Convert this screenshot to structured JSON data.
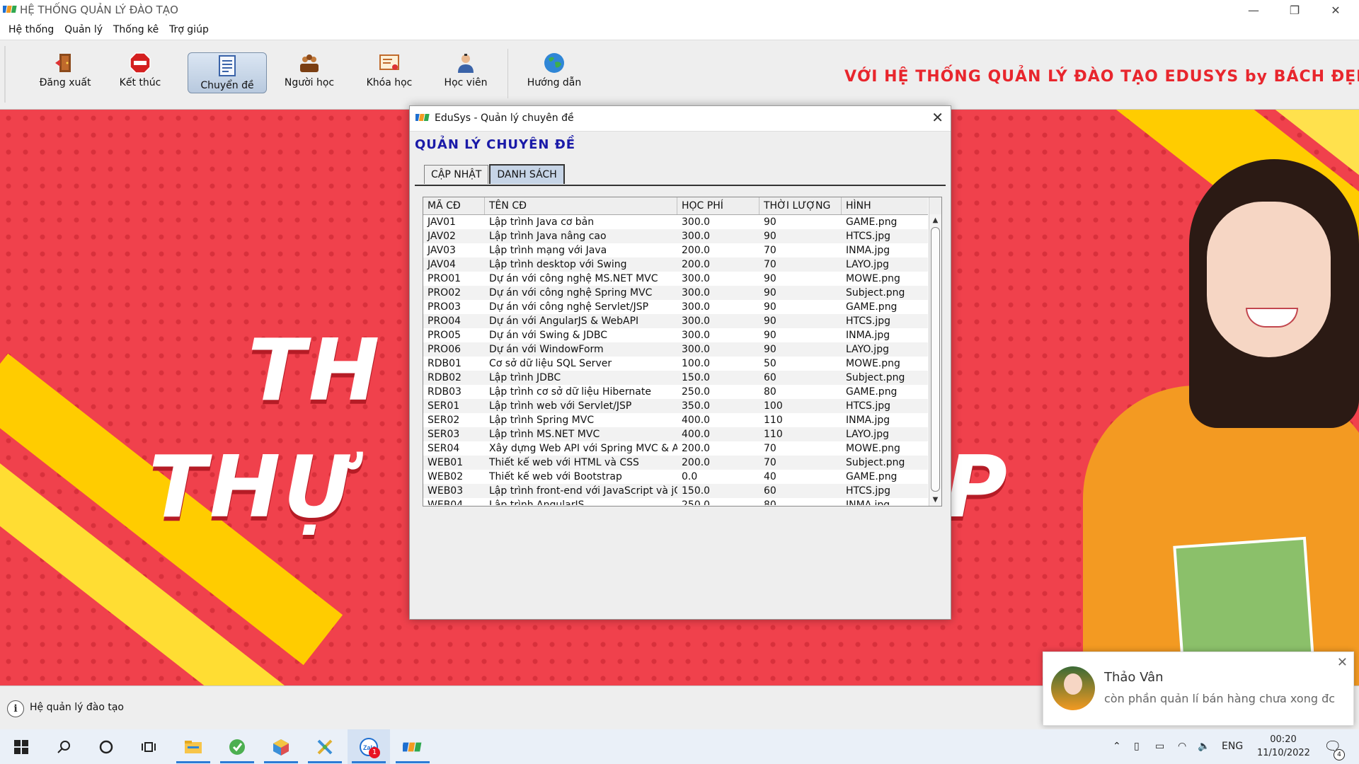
{
  "window": {
    "title": "HỆ THỐNG QUẢN LÝ ĐÀO TẠO",
    "minimize": "—",
    "restore": "❐",
    "close": "✕"
  },
  "menu": [
    "Hệ thống",
    "Quản lý",
    "Thống kê",
    "Trợ giúp"
  ],
  "toolbar": {
    "buttons": [
      "Đăng xuất",
      "Kết thúc",
      "Chuyển đề",
      "Người học",
      "Khóa học",
      "Học viên",
      "Hướng dẫn"
    ],
    "active_index": 2,
    "slogan": "VỚI HỆ THỐNG QUẢN LÝ ĐÀO TẠO EDUSYS by BÁCH ĐẸP TRAI"
  },
  "background": {
    "line1": "TH",
    "line2": "THỰ",
    "line2_tail": "P"
  },
  "dialog": {
    "title": "EduSys - Quản lý chuyên đề",
    "heading": "QUẢN LÝ CHUYÊN ĐỀ",
    "tabs": [
      "CẬP NHẬT",
      "DANH SÁCH"
    ],
    "active_tab": "DANH SÁCH",
    "columns": [
      "MÃ CĐ",
      "TÊN CĐ",
      "HỌC PHÍ",
      "THỜI LƯỢNG",
      "HÌNH"
    ],
    "rows": [
      [
        "JAV01",
        "Lập trình Java cơ bản",
        "300.0",
        "90",
        "GAME.png"
      ],
      [
        "JAV02",
        "Lập trình Java nâng cao",
        "300.0",
        "90",
        "HTCS.jpg"
      ],
      [
        "JAV03",
        "Lập trình mạng với Java",
        "200.0",
        "70",
        "INMA.jpg"
      ],
      [
        "JAV04",
        "Lập trình desktop với Swing",
        "200.0",
        "70",
        "LAYO.jpg"
      ],
      [
        "PRO01",
        "Dự án với công nghệ MS.NET MVC",
        "300.0",
        "90",
        "MOWE.png"
      ],
      [
        "PRO02",
        "Dự án với công nghệ Spring MVC",
        "300.0",
        "90",
        "Subject.png"
      ],
      [
        "PRO03",
        "Dự án với công nghệ Servlet/JSP",
        "300.0",
        "90",
        "GAME.png"
      ],
      [
        "PRO04",
        "Dự án với AngularJS & WebAPI",
        "300.0",
        "90",
        "HTCS.jpg"
      ],
      [
        "PRO05",
        "Dự án với Swing & JDBC",
        "300.0",
        "90",
        "INMA.jpg"
      ],
      [
        "PRO06",
        "Dự án với WindowForm",
        "300.0",
        "90",
        "LAYO.jpg"
      ],
      [
        "RDB01",
        "Cơ sở dữ liệu SQL Server",
        "100.0",
        "50",
        "MOWE.png"
      ],
      [
        "RDB02",
        "Lập trình JDBC",
        "150.0",
        "60",
        "Subject.png"
      ],
      [
        "RDB03",
        "Lập trình cơ sở dữ liệu Hibernate",
        "250.0",
        "80",
        "GAME.png"
      ],
      [
        "SER01",
        "Lập trình web với Servlet/JSP",
        "350.0",
        "100",
        "HTCS.jpg"
      ],
      [
        "SER02",
        "Lập trình Spring MVC",
        "400.0",
        "110",
        "INMA.jpg"
      ],
      [
        "SER03",
        "Lập trình MS.NET MVC",
        "400.0",
        "110",
        "LAYO.jpg"
      ],
      [
        "SER04",
        "Xây dựng Web API với Spring MVC & A...",
        "200.0",
        "70",
        "MOWE.png"
      ],
      [
        "WEB01",
        "Thiết kế web với HTML và CSS",
        "200.0",
        "70",
        "Subject.png"
      ],
      [
        "WEB02",
        "Thiết kế web với Bootstrap",
        "0.0",
        "40",
        "GAME.png"
      ],
      [
        "WEB03",
        "Lập trình front-end với JavaScript và jQ...",
        "150.0",
        "60",
        "HTCS.jpg"
      ],
      [
        "WEB04",
        "Lập trình AngularJS",
        "250.0",
        "80",
        "INMA.jpg"
      ]
    ]
  },
  "statusbar": {
    "text": "Hệ quản lý đào tạo"
  },
  "notification": {
    "name": "Thảo Vân",
    "message": "còn phần quản lí bán hàng chưa xong đc",
    "close": "✕"
  },
  "taskbar": {
    "badge": "1",
    "language": "ENG",
    "time": "00:20",
    "date": "11/10/2022",
    "notif_count": "4"
  },
  "colors": {
    "slogan": "#e8262d",
    "heading": "#1a1aa8",
    "background_red": "#f0414c",
    "accent_yellow": "#ffcc00"
  }
}
